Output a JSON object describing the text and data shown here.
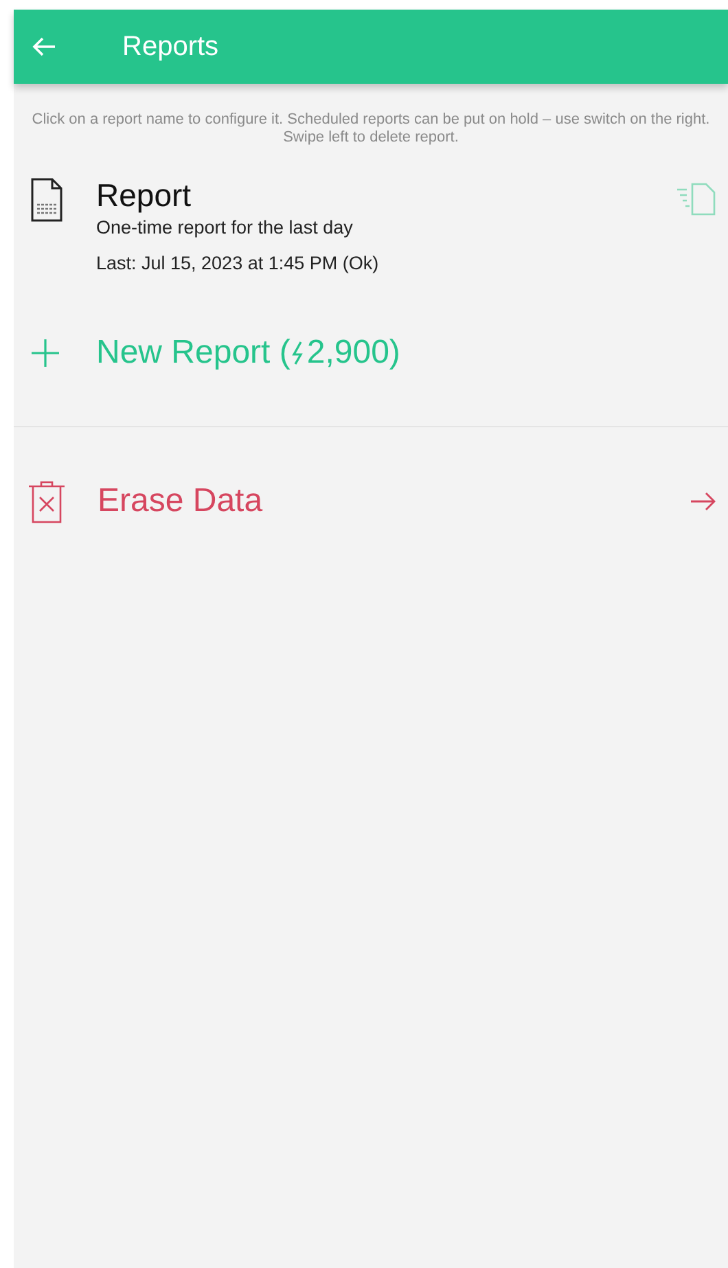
{
  "app_bar": {
    "title": "Reports"
  },
  "hint": "Click on a report name to configure it. Scheduled reports can be put on hold – use switch on the right. Swipe left to delete report.",
  "reports": [
    {
      "name": "Report",
      "description": "One-time report for the last day",
      "last_run": "Last: Jul 15, 2023 at 1:45 PM (Ok)"
    }
  ],
  "new_report": {
    "label": "New Report (",
    "cost": "2,900)"
  },
  "erase": {
    "label": "Erase Data"
  }
}
